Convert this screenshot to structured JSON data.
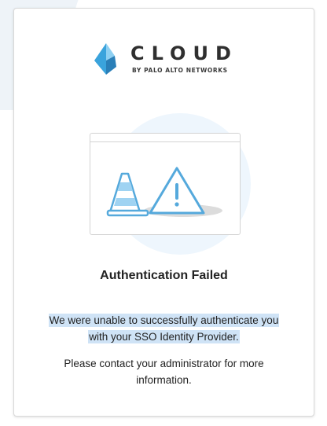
{
  "brand": {
    "name": "CLOUD",
    "tagline": "BY PALO ALTO NETWORKS",
    "logo_icon": "cortex-logo-icon",
    "accent": "#3d9ad6"
  },
  "illustration": {
    "icons": [
      "browser-window-icon",
      "traffic-cone-icon",
      "warning-triangle-icon"
    ]
  },
  "error": {
    "title": "Authentication Failed",
    "message_line1": "We were unable to successfully authenticate you",
    "message_line2": "with your SSO Identity Provider.",
    "contact_text": "Please contact your administrator for more information."
  },
  "colors": {
    "highlight": "#cfe3f6",
    "text": "#222222",
    "illustration_blue": "#55a9dc"
  }
}
